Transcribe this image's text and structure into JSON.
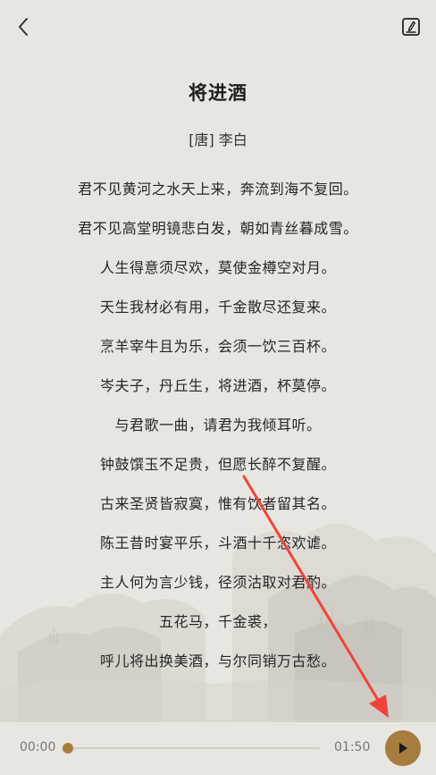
{
  "header": {
    "back_icon": "chevron-left-icon",
    "edit_icon": "edit-note-icon"
  },
  "poem": {
    "title": "将进酒",
    "author": "[唐]  李白",
    "lines": [
      "君不见黄河之水天上来，奔流到海不复回。",
      "君不见高堂明镜悲白发，朝如青丝暮成雪。",
      "人生得意须尽欢，莫使金樽空对月。",
      "天生我材必有用，千金散尽还复来。",
      "烹羊宰牛且为乐，会须一饮三百杯。",
      "岑夫子，丹丘生，将进酒，杯莫停。",
      "与君歌一曲，请君为我倾耳听。",
      "钟鼓馔玉不足贵，但愿长醉不复醒。",
      "古来圣贤皆寂寞，惟有饮者留其名。",
      "陈王昔时宴平乐，斗酒十千恣欢谑。",
      "主人何为言少钱，径须沽取对君酌。",
      "五花马，千金裘，",
      "呼儿将出换美酒，与尔同销万古愁。"
    ]
  },
  "player": {
    "current_time": "00:00",
    "total_time": "01:50",
    "progress": 0,
    "play_icon": "play-icon"
  },
  "colors": {
    "background": "#e8e6e0",
    "accent": "#a47d3f",
    "annotation_arrow": "#f0443a"
  }
}
